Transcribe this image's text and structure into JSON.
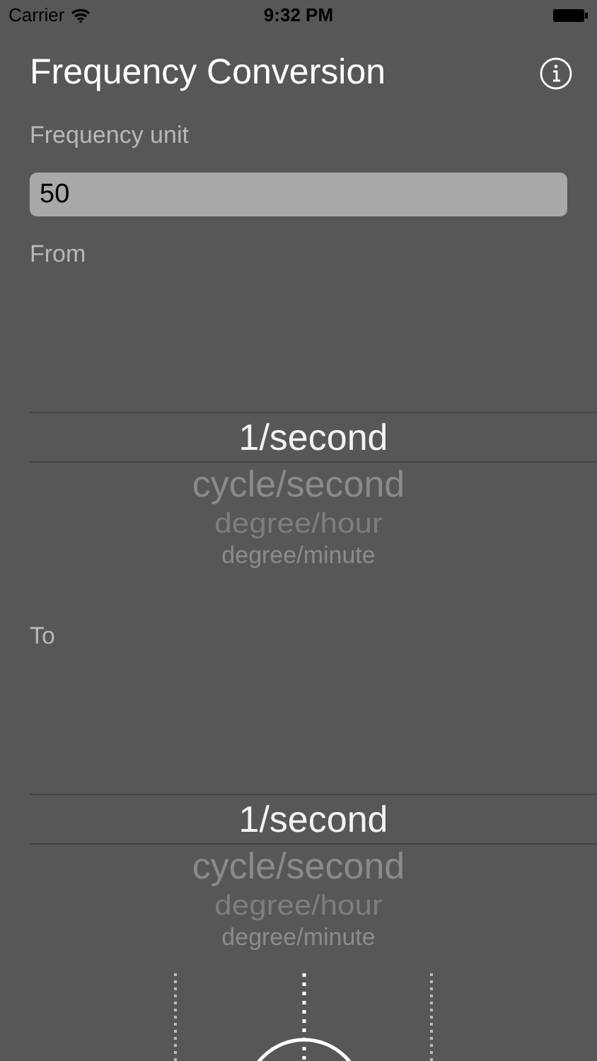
{
  "status_bar": {
    "carrier": "Carrier",
    "time": "9:32 PM"
  },
  "title": "Frequency Conversion",
  "input": {
    "label": "Frequency unit",
    "value": "50"
  },
  "pickers": [
    {
      "label": "From",
      "options": [
        {
          "text": "1/second",
          "selected": true
        },
        {
          "text": "cycle/second",
          "selected": false
        },
        {
          "text": "degree/hour",
          "selected": false
        },
        {
          "text": "degree/minute",
          "selected": false
        }
      ]
    },
    {
      "label": "To",
      "options": [
        {
          "text": "1/second",
          "selected": true
        },
        {
          "text": "cycle/second",
          "selected": false
        },
        {
          "text": "degree/hour",
          "selected": false
        },
        {
          "text": "degree/minute",
          "selected": false
        }
      ]
    }
  ]
}
